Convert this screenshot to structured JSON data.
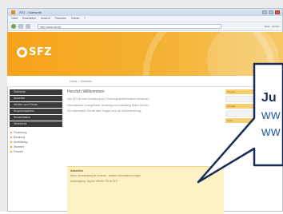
{
  "browser": {
    "title": "SFZ - Startseite",
    "menu": [
      "Datei",
      "Bearbeiten",
      "Ansicht",
      "Favoriten",
      "Extras",
      "?"
    ],
    "address": "http://www.sfz.de",
    "tabs": [
      "Seite",
      "Extras"
    ]
  },
  "site": {
    "logo_text": "SFZ",
    "breadcrumb": "Home > Startseite",
    "sidebar_dark": [
      "Startseite",
      "Aktuelles",
      "Medien und Presse",
      "Ansprechpartner",
      "Rehabilitation",
      "Netzwerke"
    ],
    "sidebar_links": [
      "Förderung",
      "Beratung",
      "Ausbildung",
      "Wohnen",
      "Freizeit"
    ],
    "heading": "Herzlich Willkommen",
    "paragraphs": [
      "Das SFZ ist eine Einrichtung zur Förderung sehbehinderter Menschen.",
      "Informationen zu Angeboten, Beratung und Ausbildung finden Sie hier.",
      "Wir unterstützen Sie bei allen Fragen rund um Sehbehinderung."
    ],
    "news_heading": "Aktuelles",
    "news_items": [
      "Neue Veranstaltung im Zentrum - weitere Informationen folgen",
      "Ankündigung: Tag der offenen Tür im SFZ"
    ],
    "right_col": [
      "Termine",
      "Kontakt",
      "Links"
    ]
  },
  "callout": {
    "title": "Ju",
    "line1": "ww",
    "line2": "ww"
  }
}
